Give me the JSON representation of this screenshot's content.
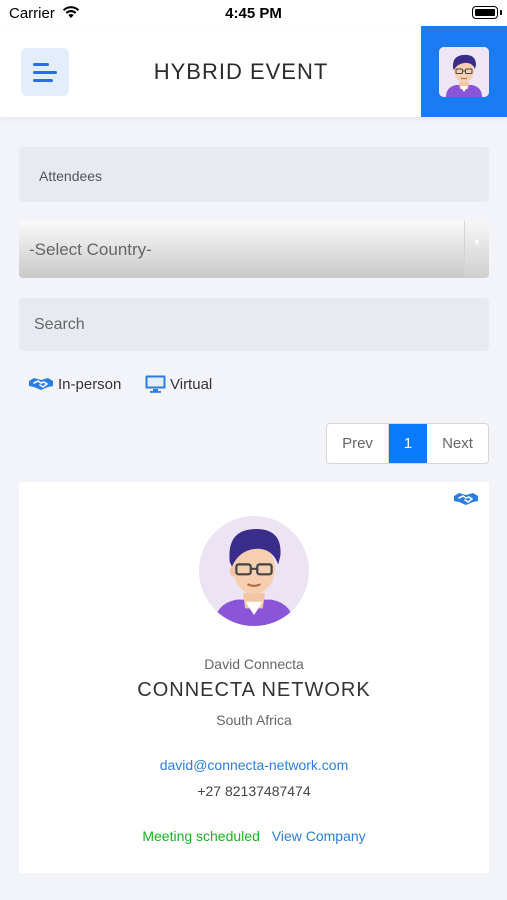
{
  "status_bar": {
    "carrier": "Carrier",
    "time": "4:45 PM"
  },
  "header": {
    "title": "HYBRID EVENT",
    "menu_icon": "hamburger-icon",
    "profile_icon": "avatar"
  },
  "filters": {
    "attendees_label": "Attendees",
    "country_select": "-Select Country-",
    "search_placeholder": "Search"
  },
  "legend": {
    "in_person": "In-person",
    "virtual": "Virtual"
  },
  "pagination": {
    "prev": "Prev",
    "current": "1",
    "next": "Next"
  },
  "attendee": {
    "name": "David Connecta",
    "company": "CONNECTA NETWORK",
    "country": "South Africa",
    "email": "david@connecta-network.com",
    "phone": "+27 82137487474",
    "status": "Meeting scheduled",
    "link": "View Company"
  },
  "colors": {
    "accent": "#1a7cf3",
    "link": "#2b7de0",
    "success": "#17b51e",
    "background": "#f2f4fa"
  }
}
